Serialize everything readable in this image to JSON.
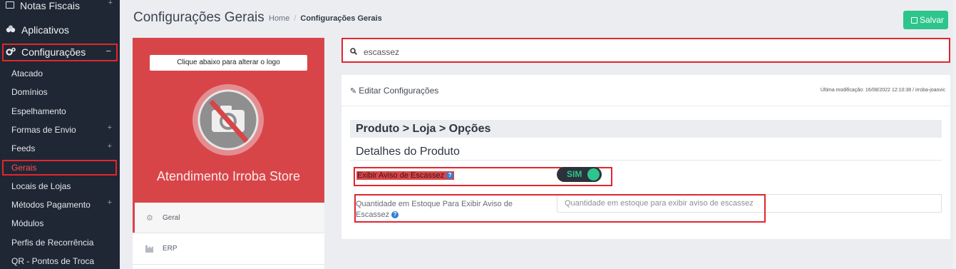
{
  "sidebar": {
    "top_item": {
      "label": "Notas Fiscais",
      "icon": "document-icon"
    },
    "apps": {
      "label": "Aplicativos",
      "icon": "cubes-icon"
    },
    "config": {
      "label": "Configurações",
      "icon": "gears-icon",
      "toggle": "−"
    },
    "items": [
      {
        "label": "Atacado",
        "expandable": false
      },
      {
        "label": "Domínios",
        "expandable": false
      },
      {
        "label": "Espelhamento",
        "expandable": false
      },
      {
        "label": "Formas de Envio",
        "expandable": true
      },
      {
        "label": "Feeds",
        "expandable": true
      },
      {
        "label": "Gerais",
        "expandable": false,
        "active": true
      },
      {
        "label": "Locais de Lojas",
        "expandable": false
      },
      {
        "label": "Métodos Pagamento",
        "expandable": true
      },
      {
        "label": "Módulos",
        "expandable": false
      },
      {
        "label": "Perfis de Recorrência",
        "expandable": false
      },
      {
        "label": "QR - Pontos de Troca",
        "expandable": false
      }
    ],
    "plus_symbol": "+"
  },
  "header": {
    "title": "Configurações Gerais",
    "breadcrumb": {
      "home": "Home",
      "separator": "/",
      "current": "Configurações Gerais"
    },
    "save_label": "Salvar"
  },
  "profile": {
    "logo_note": "Clique abaixo para alterar o logo",
    "store_name": "Atendimento Irroba Store",
    "menu": [
      {
        "label": "Geral",
        "icon": "gear-icon",
        "active": true
      },
      {
        "label": "ERP",
        "icon": "factory-icon",
        "active": false
      }
    ]
  },
  "search": {
    "value": "escassez"
  },
  "panel": {
    "title": "Editar Configurações",
    "last_modified": "Última modificação: 16/08/2022 12:10:38 / irroba-joaovic",
    "section": "Produto > Loja > Opções",
    "subsection": "Detalhes do Produto",
    "scarcity_label": "Exibir Aviso de Escassez",
    "scarcity_value": "SIM",
    "help_icon": "?",
    "qty_label": "Quantidade em Estoque Para Exibir Aviso de Escassez",
    "qty_placeholder": "Quantidade em estoque para exibir aviso de escassez"
  },
  "colors": {
    "accent_red": "#d84549",
    "highlight_red": "#e1262d",
    "green": "#2ec58c",
    "sidebar_bg": "#1f2734"
  }
}
